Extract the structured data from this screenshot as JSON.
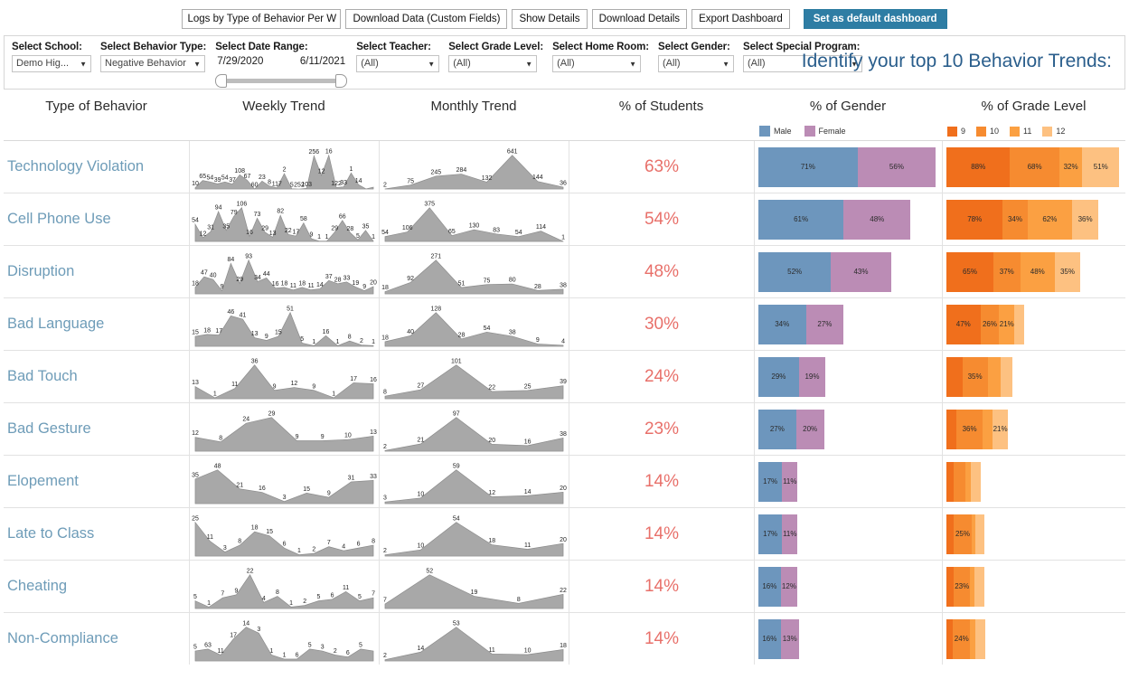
{
  "toolbar": {
    "view_select": {
      "value": "Logs by Type of Behavior Per We",
      "options": [
        "Logs by Type of Behavior Per Week"
      ]
    },
    "buttons": [
      {
        "label": "Download Data (Custom Fields)"
      },
      {
        "label": "Show Details"
      },
      {
        "label": "Download Details"
      },
      {
        "label": "Export Dashboard"
      }
    ],
    "primary_button": {
      "label": "Set as default dashboard",
      "color": "#2e7da4"
    }
  },
  "filters": {
    "school": {
      "label": "Select School:",
      "value": "Demo Hig..."
    },
    "behavior": {
      "label": "Select Behavior Type:",
      "value": "Negative Behavior"
    },
    "daterange": {
      "label": "Select Date Range:",
      "start": "7/29/2020",
      "end": "6/11/2021"
    },
    "teacher": {
      "label": "Select Teacher:",
      "value": "(All)"
    },
    "grade": {
      "label": "Select Grade Level:",
      "value": "(All)"
    },
    "homeroom": {
      "label": "Select Home Room:",
      "value": "(All)"
    },
    "gender": {
      "label": "Select Gender:",
      "value": "(All)"
    },
    "special": {
      "label": "Select Special Program:",
      "value": "(All)"
    },
    "headline": "Identify your top 10 Behavior Trends:"
  },
  "columns": [
    {
      "key": "behavior",
      "label": "Type of Behavior"
    },
    {
      "key": "weekly",
      "label": "Weekly Trend"
    },
    {
      "key": "monthly",
      "label": "Monthly Trend"
    },
    {
      "key": "students",
      "label": "% of Students"
    },
    {
      "key": "gender",
      "label": "% of Gender"
    },
    {
      "key": "grade",
      "label": "% of Grade Level"
    }
  ],
  "legends": {
    "gender": [
      {
        "label": "Male",
        "color": "#6d96bd"
      },
      {
        "label": "Female",
        "color": "#bb8cb5"
      }
    ],
    "grade": [
      {
        "label": "9",
        "color": "#f06f1c"
      },
      {
        "label": "10",
        "color": "#f68b30"
      },
      {
        "label": "11",
        "color": "#fba042"
      },
      {
        "label": "12",
        "color": "#fdc181"
      }
    ]
  },
  "chart_data": {
    "type": "table",
    "title": "Identify your top 10 Behavior Trends:",
    "columns": [
      "Type of Behavior",
      "Weekly Trend",
      "Monthly Trend",
      "% of Students",
      "% of Gender",
      "% of Grade Level"
    ],
    "rows": [
      {
        "behavior": "Technology Violation",
        "students_pct": "63%",
        "gender": {
          "male": 71,
          "female": 56,
          "male_label": "71%",
          "female_label": "56%"
        },
        "grade": {
          "g9": 88,
          "g10": 68,
          "g11": 32,
          "g12": 51,
          "labels": [
            "88%",
            "68%",
            "32%",
            "51%"
          ]
        },
        "weekly": [
          10,
          65,
          54,
          39,
          54,
          37,
          108,
          67,
          0,
          60,
          23,
          8,
          117,
          2,
          0,
          5,
          252,
          103,
          256,
          12,
          16,
          122,
          33,
          1,
          14
        ],
        "weekly_labels": [
          "10",
          "65",
          "54",
          "39",
          "54",
          "37",
          "108",
          "67",
          "60",
          "23",
          "8",
          "117",
          "2",
          "5",
          "252",
          "103",
          "256",
          "12",
          "16",
          "122",
          "33",
          "1",
          "14"
        ],
        "monthly": [
          2,
          75,
          245,
          284,
          132,
          641,
          144,
          36
        ],
        "monthly_labels": [
          "2",
          "75",
          "245",
          "284",
          "132",
          "641",
          "144",
          "36"
        ]
      },
      {
        "behavior": "Cell Phone Use",
        "students_pct": "54%",
        "gender": {
          "male": 61,
          "female": 48,
          "male_label": "61%",
          "female_label": "48%"
        },
        "grade": {
          "g9": 78,
          "g10": 34,
          "g11": 62,
          "g12": 36,
          "labels": [
            "78%",
            "34%",
            "62%",
            "36%"
          ]
        },
        "weekly": [
          54,
          12,
          31,
          94,
          35,
          79,
          106,
          16,
          73,
          29,
          13,
          82,
          22,
          17,
          58,
          9,
          1,
          1,
          29,
          66,
          28,
          5,
          35,
          1
        ],
        "weekly_labels": [
          "54",
          "12",
          "31",
          "94",
          "35",
          "79",
          "106",
          "16",
          "73",
          "29",
          "13",
          "82",
          "22",
          "17",
          "58",
          "9",
          "1",
          "1",
          "29",
          "66",
          "28",
          "5",
          "35",
          "1"
        ],
        "monthly": [
          54,
          106,
          375,
          65,
          130,
          83,
          54,
          114,
          1
        ],
        "monthly_labels": [
          "54",
          "106",
          "375",
          "65",
          "130",
          "83",
          "54",
          "114",
          "1"
        ]
      },
      {
        "behavior": "Disruption",
        "students_pct": "48%",
        "gender": {
          "male": 52,
          "female": 43,
          "male_label": "52%",
          "female_label": "43%"
        },
        "grade": {
          "g9": 65,
          "g10": 37,
          "g11": 48,
          "g12": 35,
          "labels": [
            "65%",
            "37%",
            "48%",
            "35%"
          ]
        },
        "weekly": [
          18,
          47,
          40,
          9,
          84,
          29,
          93,
          34,
          44,
          16,
          18,
          11,
          18,
          11,
          14,
          37,
          28,
          33,
          19,
          9,
          20
        ],
        "weekly_labels": [
          "18",
          "47",
          "40",
          "9",
          "84",
          "29",
          "93",
          "34",
          "44",
          "16",
          "18",
          "11",
          "18",
          "11",
          "14",
          "37",
          "28",
          "33",
          "19",
          "9",
          "20"
        ],
        "monthly": [
          18,
          92,
          271,
          51,
          75,
          80,
          28,
          38
        ],
        "monthly_labels": [
          "18",
          "92",
          "271",
          "51",
          "75",
          "80",
          "28",
          "38"
        ]
      },
      {
        "behavior": "Bad Language",
        "students_pct": "30%",
        "gender": {
          "male": 34,
          "female": 27,
          "male_label": "34%",
          "female_label": "27%"
        },
        "grade": {
          "g9": 47,
          "g10": 26,
          "g11": 21,
          "g12": 14,
          "labels": [
            "47%",
            "26%",
            "21%",
            ""
          ]
        },
        "weekly": [
          15,
          18,
          17,
          46,
          41,
          13,
          9,
          15,
          51,
          5,
          1,
          16,
          1,
          8,
          2,
          1
        ],
        "weekly_labels": [
          "15",
          "18",
          "17",
          "46",
          "41",
          "13",
          "9",
          "15",
          "51",
          "5",
          "1",
          "16",
          "1",
          "8",
          "2",
          "1"
        ],
        "monthly": [
          18,
          40,
          128,
          28,
          54,
          38,
          9,
          4
        ],
        "monthly_labels": [
          "18",
          "40",
          "128",
          "28",
          "54",
          "38",
          "9",
          "4"
        ]
      },
      {
        "behavior": "Bad Touch",
        "students_pct": "24%",
        "gender": {
          "male": 29,
          "female": 19,
          "male_label": "29%",
          "female_label": "19%"
        },
        "grade": {
          "g9": 22,
          "g10": 35,
          "g11": 18,
          "g12": 16,
          "labels": [
            "",
            "35%",
            "",
            ""
          ]
        },
        "weekly": [
          13,
          1,
          11,
          36,
          9,
          12,
          9,
          1,
          17,
          16
        ],
        "weekly_labels": [
          "13",
          "1",
          "11",
          "36",
          "9",
          "12",
          "9",
          "1",
          "17",
          "16"
        ],
        "monthly": [
          8,
          27,
          101,
          22,
          25,
          39
        ],
        "monthly_labels": [
          "8",
          "27",
          "101",
          "22",
          "25",
          "39"
        ]
      },
      {
        "behavior": "Bad Gesture",
        "students_pct": "23%",
        "gender": {
          "male": 27,
          "female": 20,
          "male_label": "27%",
          "female_label": "20%"
        },
        "grade": {
          "g9": 14,
          "g10": 36,
          "g11": 14,
          "g12": 21,
          "labels": [
            "",
            "36%",
            "",
            "21%"
          ]
        },
        "weekly": [
          12,
          8,
          24,
          29,
          9,
          9,
          10,
          13
        ],
        "weekly_labels": [
          "12",
          "8",
          "24",
          "29",
          "9",
          "9",
          "10",
          "13"
        ],
        "monthly": [
          2,
          21,
          97,
          20,
          16,
          38
        ],
        "monthly_labels": [
          "2",
          "21",
          "97",
          "20",
          "16",
          "38"
        ]
      },
      {
        "behavior": "Elopement",
        "students_pct": "14%",
        "gender": {
          "male": 17,
          "female": 11,
          "male_label": "17%",
          "female_label": "11%"
        },
        "grade": {
          "g9": 10,
          "g10": 16,
          "g11": 8,
          "g12": 14,
          "labels": [
            "",
            "",
            "",
            ""
          ]
        },
        "weekly": [
          35,
          48,
          21,
          16,
          3,
          15,
          9,
          31,
          33
        ],
        "weekly_labels": [
          "35",
          "48",
          "21",
          "16",
          "3",
          "15",
          "9",
          "31",
          "33"
        ],
        "monthly": [
          3,
          10,
          59,
          12,
          14,
          20
        ],
        "monthly_labels": [
          "3",
          "10",
          "59",
          "12",
          "14",
          "20"
        ]
      },
      {
        "behavior": "Late to Class",
        "students_pct": "14%",
        "gender": {
          "male": 17,
          "female": 11,
          "male_label": "17%",
          "female_label": "11%"
        },
        "grade": {
          "g9": 10,
          "g10": 25,
          "g11": 5,
          "g12": 12,
          "labels": [
            "",
            "25%",
            "",
            ""
          ]
        },
        "weekly": [
          25,
          11,
          3,
          8,
          18,
          15,
          6,
          1,
          2,
          7,
          4,
          6,
          8
        ],
        "weekly_labels": [
          "25",
          "11",
          "3",
          "8",
          "18",
          "15",
          "6",
          "1",
          "2",
          "7",
          "4",
          "6",
          "8"
        ],
        "monthly": [
          2,
          10,
          54,
          18,
          11,
          20
        ],
        "monthly_labels": [
          "2",
          "10",
          "54",
          "18",
          "11",
          "20"
        ]
      },
      {
        "behavior": "Cheating",
        "students_pct": "14%",
        "gender": {
          "male": 16,
          "female": 12,
          "male_label": "16%",
          "female_label": "12%"
        },
        "grade": {
          "g9": 10,
          "g10": 23,
          "g11": 6,
          "g12": 14,
          "labels": [
            "",
            "23%",
            "",
            ""
          ]
        },
        "weekly": [
          5,
          1,
          7,
          9,
          22,
          4,
          8,
          1,
          2,
          5,
          6,
          11,
          5,
          7
        ],
        "weekly_labels": [
          "5",
          "1",
          "7",
          "9",
          "22",
          "4",
          "8",
          "1",
          "2",
          "5",
          "6",
          "11",
          "5",
          "7"
        ],
        "monthly": [
          7,
          52,
          19,
          8,
          22
        ],
        "monthly_labels": [
          "7",
          "52",
          "19",
          "8",
          "22"
        ]
      },
      {
        "behavior": "Non-Compliance",
        "students_pct": "14%",
        "gender": {
          "male": 16,
          "female": 13,
          "male_label": "16%",
          "female_label": "13%"
        },
        "grade": {
          "g9": 9,
          "g10": 24,
          "g11": 7,
          "g12": 14,
          "labels": [
            "",
            "24%",
            "",
            ""
          ]
        },
        "weekly": [
          5,
          6,
          3,
          11,
          17,
          14,
          3,
          1,
          1,
          6,
          5,
          3,
          2,
          6,
          5
        ],
        "weekly_labels": [
          "5",
          "63",
          "11",
          "17",
          "14",
          "3",
          "1",
          "1",
          "6",
          "5",
          "3",
          "2",
          "6",
          "5"
        ],
        "monthly": [
          2,
          14,
          53,
          11,
          10,
          18
        ],
        "monthly_labels": [
          "2",
          "14",
          "53",
          "11",
          "10",
          "18"
        ]
      }
    ]
  }
}
